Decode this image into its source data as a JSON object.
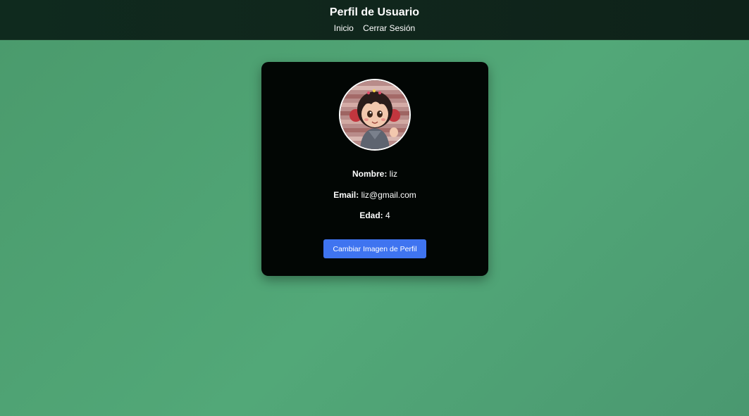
{
  "header": {
    "title": "Perfil de Usuario",
    "nav": {
      "home_label": "Inicio",
      "logout_label": "Cerrar Sesión"
    }
  },
  "profile": {
    "avatar_icon": "profile-photo-cartoon-girl",
    "name_label": "Nombre:",
    "name_value": "liz",
    "email_label": "Email:",
    "email_value": "liz@gmail.com",
    "age_label": "Edad:",
    "age_value": "4",
    "change_image_label": "Cambiar Imagen de Perfil"
  },
  "colors": {
    "page_background": "#4fa474",
    "header_background": "#0f261c",
    "card_background": "#020604",
    "button": "#3f74f0"
  }
}
